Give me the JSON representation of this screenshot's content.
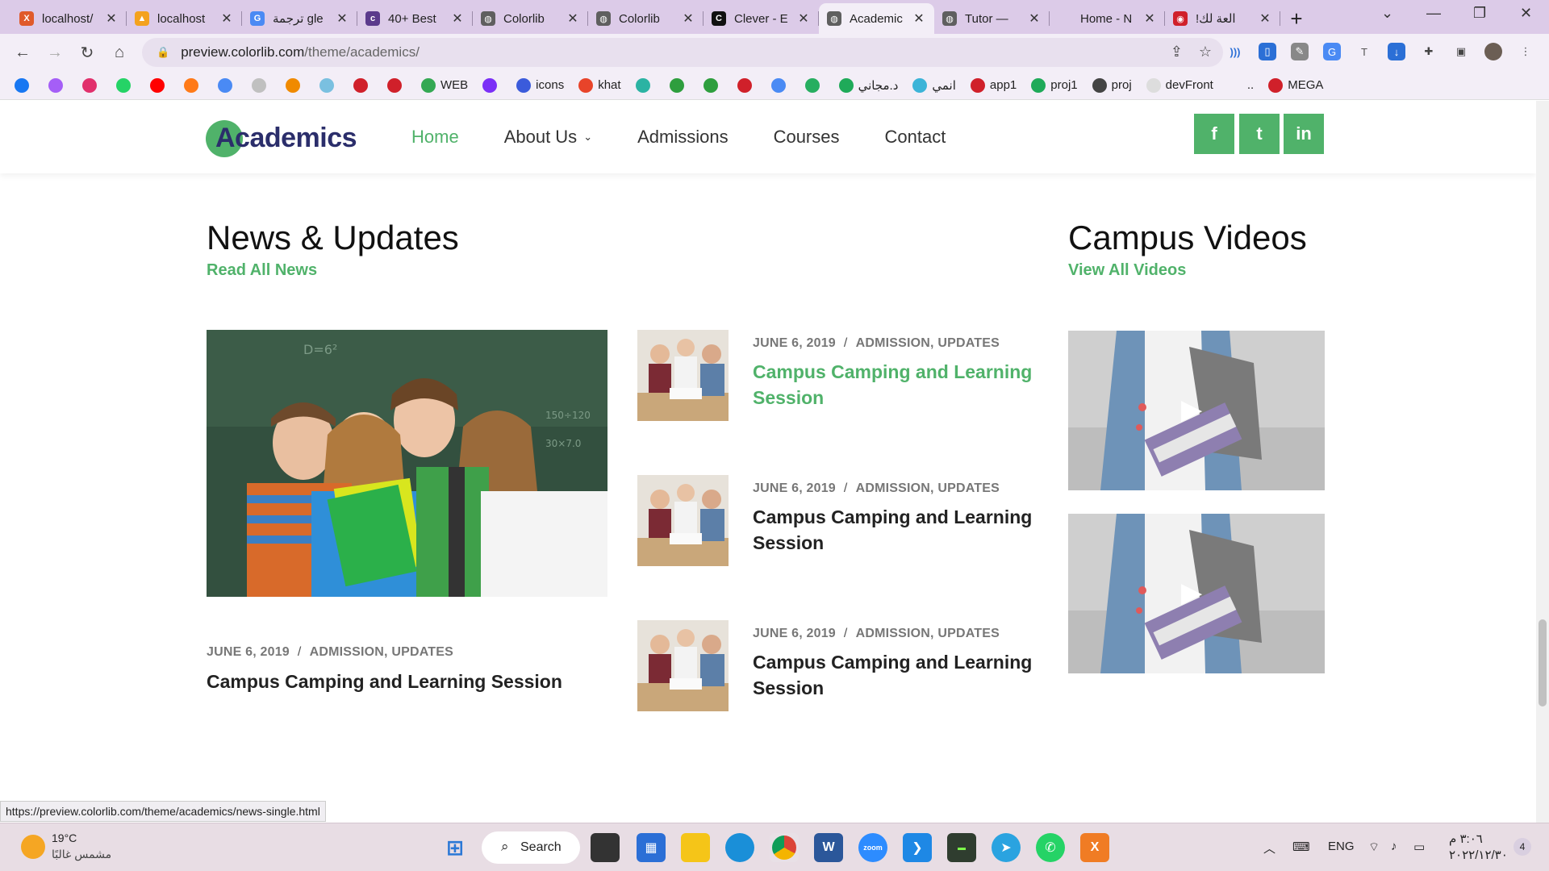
{
  "browser": {
    "tabs": [
      {
        "label": "localhost/",
        "icon_color": "#e05a2a",
        "icon_text": "X"
      },
      {
        "label": "localhost",
        "icon_color": "#f4a21e",
        "icon_text": "▲"
      },
      {
        "label": "ترجمة gle",
        "icon_color": "#4a8af4",
        "icon_text": "G"
      },
      {
        "label": "40+ Best",
        "icon_color": "#5b3a8c",
        "icon_text": "c"
      },
      {
        "label": "Colorlib",
        "icon_color": "#5f5f5f",
        "icon_text": "◍"
      },
      {
        "label": "Colorlib",
        "icon_color": "#5f5f5f",
        "icon_text": "◍"
      },
      {
        "label": "Clever - E",
        "icon_color": "#111111",
        "icon_text": "C"
      },
      {
        "label": "Academic",
        "icon_color": "#5f5f5f",
        "icon_text": "◍",
        "active": true
      },
      {
        "label": "Tutor —",
        "icon_color": "#5f5f5f",
        "icon_text": "◍"
      },
      {
        "label": "Home - N",
        "icon_color": "#dccbe8",
        "icon_text": ""
      },
      {
        "label": "!العة لك",
        "icon_color": "#d0202a",
        "icon_text": "◉"
      }
    ],
    "url_host": "preview.colorlib.com",
    "url_path": "/theme/academics/",
    "bookmarks": [
      {
        "label": "",
        "color": "#1877f2"
      },
      {
        "label": "",
        "color": "#a55ef7"
      },
      {
        "label": "",
        "color": "#e1306c"
      },
      {
        "label": "",
        "color": "#25d366"
      },
      {
        "label": "",
        "color": "#ff0000"
      },
      {
        "label": "",
        "color": "#ff7a18"
      },
      {
        "label": "",
        "color": "#4a8af4"
      },
      {
        "label": "",
        "color": "#c0c0c0"
      },
      {
        "label": "",
        "color": "#f08a00"
      },
      {
        "label": "",
        "color": "#7ac0e0"
      },
      {
        "label": "",
        "color": "#d0202a"
      },
      {
        "label": "",
        "color": "#d0202a"
      },
      {
        "label": "WEB",
        "color": "#34a853"
      },
      {
        "label": "",
        "color": "#7b2ff7"
      },
      {
        "label": "icons",
        "color": "#3b5bdb"
      },
      {
        "label": "khat",
        "color": "#e8442a"
      },
      {
        "label": "",
        "color": "#2bb3a3"
      },
      {
        "label": "",
        "color": "#2e9e3e"
      },
      {
        "label": "",
        "color": "#2e9e3e"
      },
      {
        "label": "",
        "color": "#d0202a"
      },
      {
        "label": "",
        "color": "#4a8af4"
      },
      {
        "label": "",
        "color": "#27ae60"
      },
      {
        "label": "د.مجاني",
        "color": "#1faa59"
      },
      {
        "label": "انمي",
        "color": "#3cb4d8"
      },
      {
        "label": "app1",
        "color": "#d0202a"
      },
      {
        "label": "proj1",
        "color": "#1faa59"
      },
      {
        "label": "proj",
        "color": "#444444"
      },
      {
        "label": "devFront",
        "color": "#dddddd"
      },
      {
        "label": "..",
        "color": "#f3eef7"
      },
      {
        "label": "MEGA",
        "color": "#d0202a"
      }
    ],
    "status_url": "https://preview.colorlib.com/theme/academics/news-single.html"
  },
  "site": {
    "logo_text": "Academics",
    "nav": [
      {
        "label": "Home",
        "active": true
      },
      {
        "label": "About Us",
        "dropdown": true
      },
      {
        "label": "Admissions"
      },
      {
        "label": "Courses"
      },
      {
        "label": "Contact"
      }
    ],
    "social": [
      "f",
      "t",
      "in"
    ],
    "news": {
      "title": "News & Updates",
      "link": "Read All News",
      "featured": {
        "date": "JUNE 6, 2019",
        "categories": "ADMISSION, UPDATES",
        "title": "Campus Camping and Learning Session"
      },
      "items": [
        {
          "date": "JUNE 6, 2019",
          "categories": "ADMISSION, UPDATES",
          "title_line1": "Campus Camping and Learning",
          "title_line2": "Session",
          "hover": true
        },
        {
          "date": "JUNE 6, 2019",
          "categories": "ADMISSION, UPDATES",
          "title_line1": "Campus Camping and Learning",
          "title_line2": "Session"
        },
        {
          "date": "JUNE 6, 2019",
          "categories": "ADMISSION, UPDATES",
          "title_line1": "Campus Camping and Learning",
          "title_line2": "Session"
        }
      ]
    },
    "videos": {
      "title": "Campus Videos",
      "link": "View All Videos",
      "play_icon": "▶"
    }
  },
  "taskbar": {
    "weather_temp": "19°C",
    "weather_text": "مشمس غالبًا",
    "search_label": "Search",
    "lang": "ENG",
    "time": "٣:٠٦ م",
    "date": "٢٠٢٢/١٢/٣٠",
    "badge": "4"
  },
  "colors": {
    "accent": "#50b26a",
    "logo_navy": "#2b2e6b"
  }
}
